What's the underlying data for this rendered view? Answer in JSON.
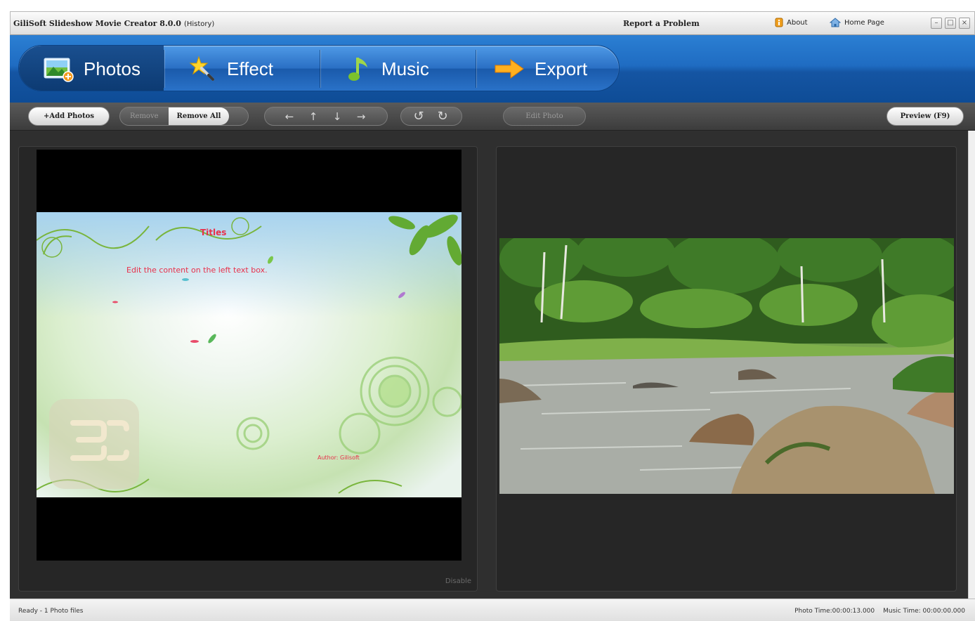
{
  "window": {
    "title": "GiliSoft Slideshow Movie Creator 8.0.0",
    "subtitle": "(History)",
    "report_link": "Report a Problem",
    "about_label": "About",
    "home_label": "Home Page",
    "controls": {
      "minimize": "–",
      "maximize": "□",
      "close": "×"
    }
  },
  "tabs": [
    {
      "label": "Photos",
      "icon": "photos-icon",
      "active": true
    },
    {
      "label": "Effect",
      "icon": "effect-wand-icon",
      "active": false
    },
    {
      "label": "Music",
      "icon": "music-note-icon",
      "active": false
    },
    {
      "label": "Export",
      "icon": "export-arrow-icon",
      "active": false
    }
  ],
  "toolbar": {
    "add_photos": "+Add Photos",
    "remove": "Remove",
    "remove_all": "Remove All",
    "move_left": "←",
    "move_up": "↑",
    "move_down": "↓",
    "move_right": "→",
    "rotate_left": "↺",
    "rotate_right": "↻",
    "edit_photo": "Edit Photo",
    "preview": "Preview (F9)"
  },
  "left_panel": {
    "slide_title": "Titles",
    "slide_text": "Edit the content on the left text box.",
    "slide_author": "Author: Gilisoft",
    "disable_label": "Disable"
  },
  "status": {
    "left": "Ready - 1 Photo files",
    "photo_time": "Photo Time:00:00:13.000",
    "music_time": "Music Time:  00:00:00.000"
  },
  "colors": {
    "tab_bar": "#1f6cc2",
    "slide_text": "#e8304a",
    "workspace": "#2f2f2f"
  }
}
